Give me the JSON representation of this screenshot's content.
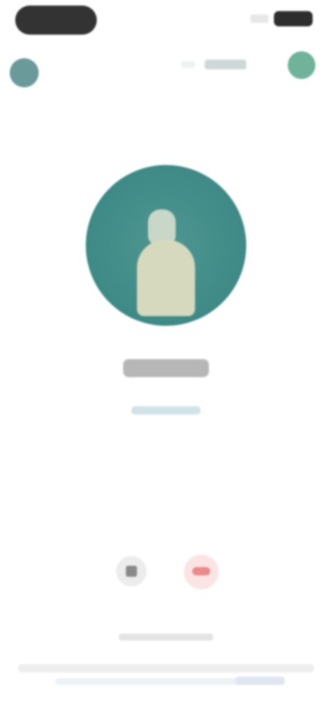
{
  "colors": {
    "accent": "#3e8a86",
    "menu": "#6fb49a",
    "danger": "#ea8a8a"
  },
  "icons": {
    "profile": "avatar-icon",
    "menu": "menu-icon",
    "action_a": "mute-icon",
    "action_b": "end-call-icon"
  }
}
